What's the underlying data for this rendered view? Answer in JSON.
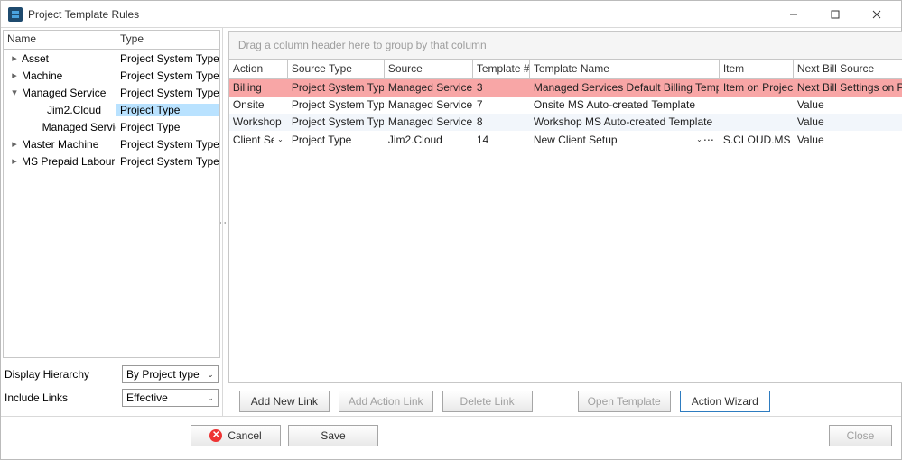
{
  "window": {
    "title": "Project Template Rules"
  },
  "tree": {
    "headers": {
      "name": "Name",
      "type": "Type"
    },
    "rows": [
      {
        "label": "Asset",
        "type": "Project System Type",
        "level": 0,
        "expandable": true,
        "expanded": false
      },
      {
        "label": "Machine",
        "type": "Project System Type",
        "level": 0,
        "expandable": true,
        "expanded": false
      },
      {
        "label": "Managed Service",
        "type": "Project System Type",
        "level": 0,
        "expandable": true,
        "expanded": true
      },
      {
        "label": "Jim2.Cloud",
        "type": "Project Type",
        "level": 1,
        "expandable": false,
        "selected": true
      },
      {
        "label": "Managed Service",
        "type": "Project Type",
        "level": 1,
        "expandable": false
      },
      {
        "label": "Master Machine",
        "type": "Project System Type",
        "level": 0,
        "expandable": true,
        "expanded": false
      },
      {
        "label": "MS Prepaid Labour",
        "type": "Project System Type",
        "level": 0,
        "expandable": true,
        "expanded": false
      }
    ]
  },
  "left_controls": {
    "display_hierarchy_label": "Display Hierarchy",
    "display_hierarchy_value": "By Project type",
    "include_links_label": "Include Links",
    "include_links_value": "Effective"
  },
  "grid": {
    "group_placeholder": "Drag a column header here to group by that column",
    "headers": {
      "action": "Action",
      "source_type": "Source Type",
      "source": "Source",
      "template_num": "Template #",
      "template_name": "Template Name",
      "item": "Item",
      "next_bill": "Next Bill Source"
    },
    "rows": [
      {
        "action": "Billing",
        "source_type": "Project System Type",
        "source": "Managed Service",
        "template_num": "3",
        "template_name": "Managed Services Default Billing Template",
        "item": "Item on Project",
        "next_bill": "Next Bill Settings on Project",
        "highlight": true
      },
      {
        "action": "Onsite",
        "source_type": "Project System Type",
        "source": "Managed Service",
        "template_num": "7",
        "template_name": "Onsite MS Auto-created Template",
        "item": "",
        "next_bill": "Value"
      },
      {
        "action": "Workshop",
        "source_type": "Project System Type",
        "source": "Managed Service",
        "template_num": "8",
        "template_name": "Workshop MS Auto-created Template",
        "item": "",
        "next_bill": "Value",
        "alt": true
      },
      {
        "action": "Client Se",
        "source_type": "Project Type",
        "source": "Jim2.Cloud",
        "template_num": "14",
        "template_name": "New Client Setup",
        "item": "S.CLOUD.MS",
        "next_bill": "Value",
        "editing": true
      }
    ]
  },
  "buttons": {
    "add_new_link": "Add New Link",
    "add_action_link": "Add Action Link",
    "delete_link": "Delete Link",
    "open_template": "Open Template",
    "action_wizard": "Action Wizard",
    "cancel": "Cancel",
    "save": "Save",
    "close": "Close"
  }
}
